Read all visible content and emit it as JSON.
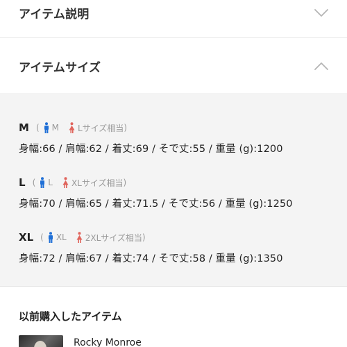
{
  "sections": {
    "description": {
      "title": "アイテム説明",
      "expanded": false
    },
    "size": {
      "title": "アイテムサイズ",
      "expanded": true
    }
  },
  "sizes": [
    {
      "code": "M",
      "paren_open": "(",
      "male": "M",
      "female": "Lサイズ相当",
      "paren_close": ")",
      "measure": "身幅:66 / 肩幅:62 / 着丈:69 / そで丈:55 / 重量 (g):1200"
    },
    {
      "code": "L",
      "paren_open": "(",
      "male": "L",
      "female": "XLサイズ相当",
      "paren_close": ")",
      "measure": "身幅:70 / 肩幅:65 / 着丈:71.5 / そで丈:56 / 重量 (g):1250"
    },
    {
      "code": "XL",
      "paren_open": "(",
      "male": "XL",
      "female": "2XLサイズ相当",
      "paren_close": ")",
      "measure": "身幅:72 / 肩幅:67 / 着丈:74 / そで丈:58 / 重量 (g):1350"
    }
  ],
  "previous": {
    "title": "以前購入したアイテム",
    "items": [
      {
        "name": "Rocky Monroe"
      }
    ]
  },
  "colors": {
    "male_icon": "#1f6fd6",
    "female_icon": "#e0645c",
    "section_bg": "#f4f4f4",
    "chevron": "#b5b5b5"
  },
  "icons": {
    "collapsed": "chevron-down-icon",
    "expanded": "chevron-up-icon",
    "male": "male-icon",
    "female": "female-icon"
  }
}
